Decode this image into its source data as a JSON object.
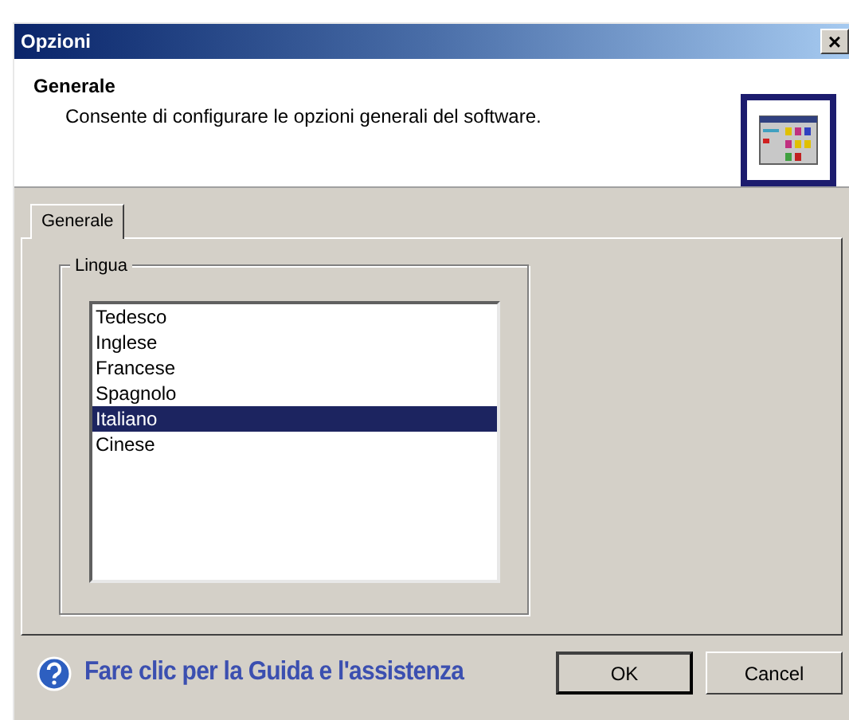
{
  "window": {
    "title": "Opzioni",
    "close": "×"
  },
  "header": {
    "title": "Generale",
    "description": "Consente di configurare le opzioni generali del software."
  },
  "tabs": [
    {
      "label": "Generale",
      "selected": true
    }
  ],
  "group": {
    "label": "Lingua"
  },
  "languages": [
    {
      "label": "Tedesco",
      "selected": false
    },
    {
      "label": "Inglese",
      "selected": false
    },
    {
      "label": "Francese",
      "selected": false
    },
    {
      "label": "Spagnolo",
      "selected": false
    },
    {
      "label": "Italiano",
      "selected": true
    },
    {
      "label": "Cinese",
      "selected": false
    }
  ],
  "help_link": "Fare clic per la Guida e l'assistenza",
  "buttons": [
    {
      "label": "OK",
      "default": true
    },
    {
      "label": "Cancel",
      "default": false
    }
  ]
}
